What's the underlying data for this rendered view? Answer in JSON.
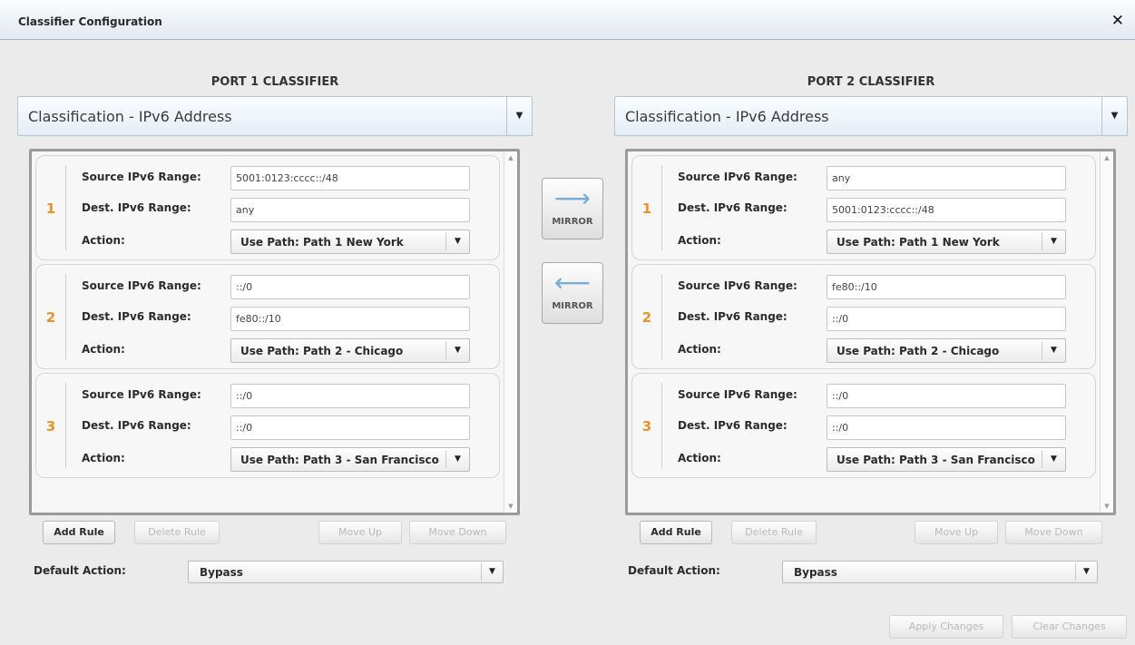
{
  "window": {
    "title": "Classifier Configuration",
    "close_glyph": "✕"
  },
  "mirror_right": {
    "arrow": "⟶",
    "label": "MIRROR"
  },
  "mirror_left": {
    "arrow": "⟵",
    "label": "MIRROR"
  },
  "port1": {
    "title": "PORT 1 CLASSIFIER",
    "classification": "Classification - IPv6 Address",
    "labels": {
      "source": "Source IPv6 Range:",
      "dest": "Dest. IPv6 Range:",
      "action": "Action:"
    },
    "rules": [
      {
        "num": "1",
        "source": "5001:0123:cccc::/48",
        "dest": "any",
        "action": "Use Path: Path 1 New York"
      },
      {
        "num": "2",
        "source": "::/0",
        "dest": "fe80::/10",
        "action": "Use Path: Path 2 - Chicago"
      },
      {
        "num": "3",
        "source": "::/0",
        "dest": "::/0",
        "action": "Use Path: Path 3 - San Francisco"
      }
    ],
    "buttons": {
      "add": "Add Rule",
      "delete": "Delete Rule",
      "move_up": "Move Up",
      "move_down": "Move Down"
    },
    "default_action_label": "Default Action:",
    "default_action_value": "Bypass"
  },
  "port2": {
    "title": "PORT 2 CLASSIFIER",
    "classification": "Classification - IPv6 Address",
    "labels": {
      "source": "Source IPv6 Range:",
      "dest": "Dest. IPv6 Range:",
      "action": "Action:"
    },
    "rules": [
      {
        "num": "1",
        "source": "any",
        "dest": "5001:0123:cccc::/48",
        "action": "Use Path: Path 1 New York"
      },
      {
        "num": "2",
        "source": "fe80::/10",
        "dest": "::/0",
        "action": "Use Path: Path 2 - Chicago"
      },
      {
        "num": "3",
        "source": "::/0",
        "dest": "::/0",
        "action": "Use Path: Path 3 - San Francisco"
      }
    ],
    "buttons": {
      "add": "Add Rule",
      "delete": "Delete Rule",
      "move_up": "Move Up",
      "move_down": "Move Down"
    },
    "default_action_label": "Default Action:",
    "default_action_value": "Bypass"
  },
  "footer": {
    "apply": "Apply Changes",
    "clear": "Clear Changes"
  },
  "colors": {
    "rule_number": "#e8932c",
    "mirror_arrow": "#7aaad6",
    "title_bar": "#e3e9ef"
  }
}
